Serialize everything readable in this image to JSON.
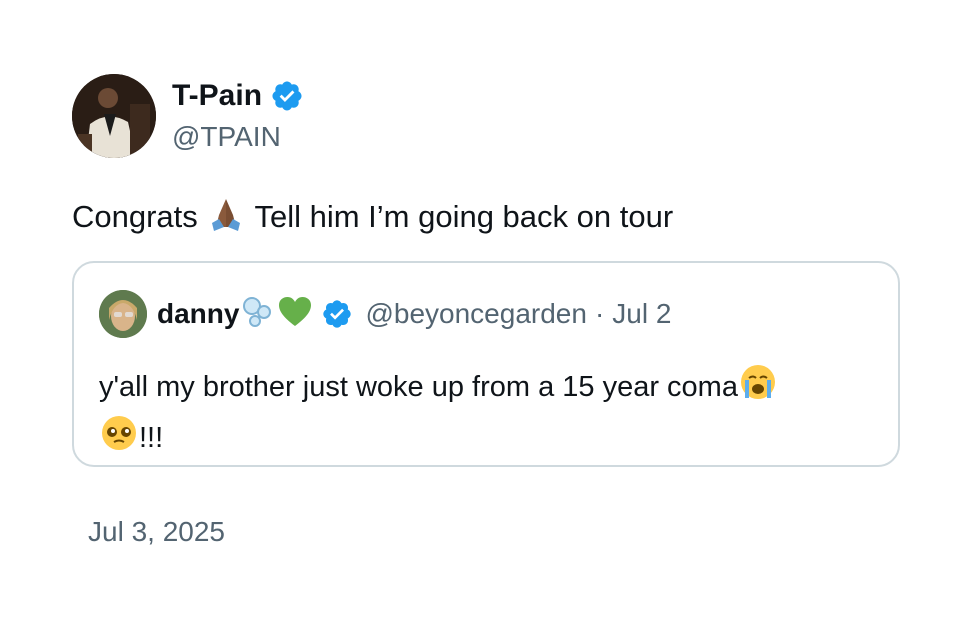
{
  "author": {
    "display_name": "T-Pain",
    "handle": "@TPAIN",
    "verified_color": "#1d9bf0"
  },
  "tweet": {
    "text_before_emoji": "Congrats ",
    "emoji_1": "folded-hands-icon",
    "text_after_emoji": " Tell him I’m going back on tour"
  },
  "quoted_tweet": {
    "display_name": "danny",
    "name_emojis": [
      "bubbles-icon",
      "green-heart-icon"
    ],
    "handle": "@beyoncegarden",
    "separator": "·",
    "date": "Jul 2",
    "text": "y'all my brother just woke up from a 15 year coma",
    "text_emoji_1": "loudly-crying-face-icon",
    "text_emoji_2": "pleading-face-icon",
    "text_tail": "!!!"
  },
  "timestamp": "Jul 3, 2025",
  "colors": {
    "text_primary": "#0f1419",
    "text_secondary": "#536471",
    "border": "#cfd9de",
    "verified": "#1d9bf0"
  }
}
